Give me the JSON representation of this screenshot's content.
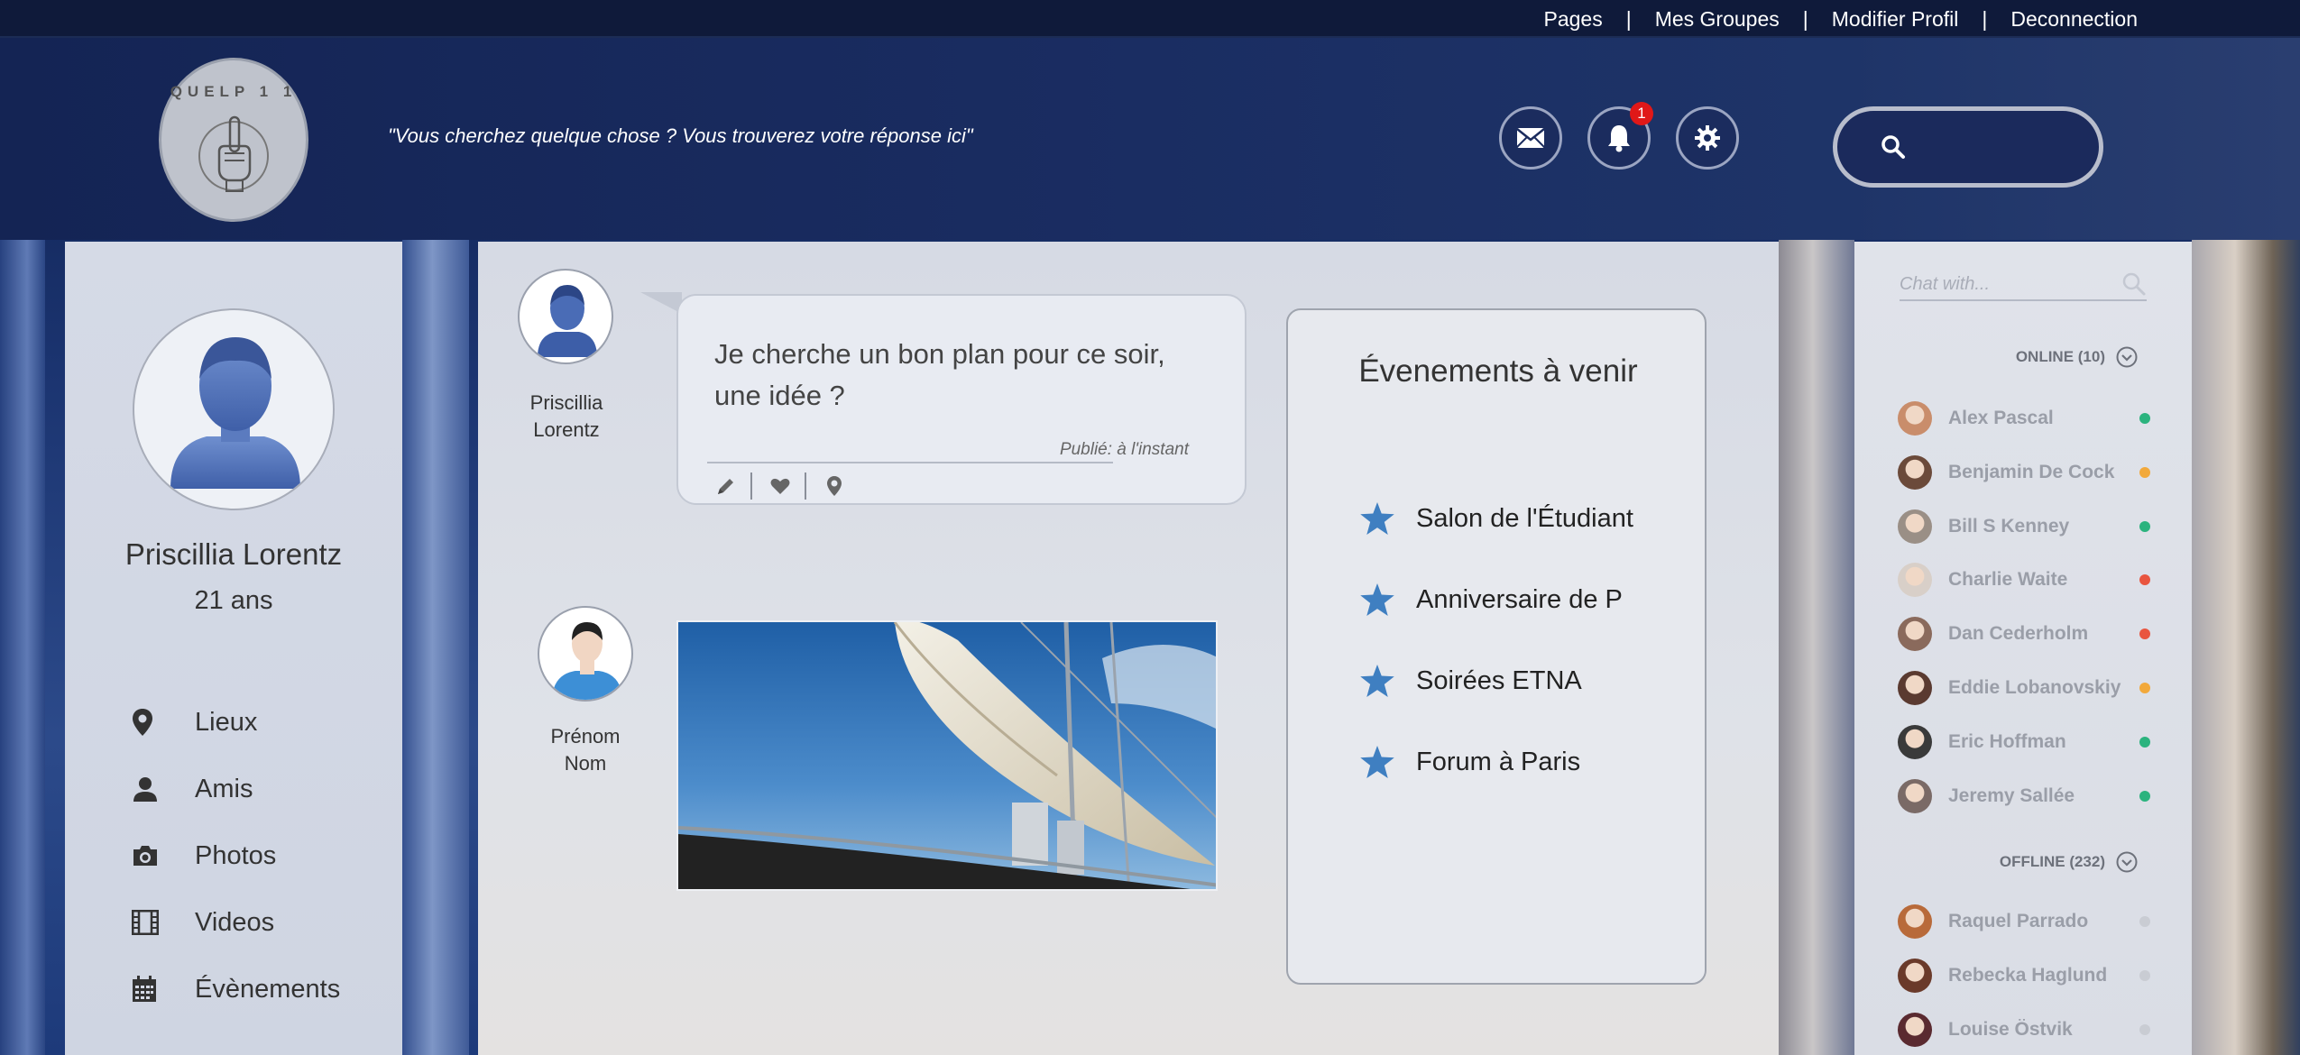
{
  "topnav": {
    "links": [
      "Pages",
      "Mes Groupes",
      "Modifier Profil",
      "Deconnection"
    ],
    "separator": "|"
  },
  "header": {
    "logo_text": "QUELP 1 1",
    "tagline": "\"Vous cherchez quelque chose ? Vous trouverez votre réponse ici\"",
    "notification_count": "1",
    "icons": [
      "mail-icon",
      "bell-icon",
      "gear-icon",
      "search-icon"
    ],
    "search_placeholder": ""
  },
  "profile": {
    "name": "Priscillia Lorentz",
    "age": "21 ans",
    "menu": [
      {
        "label": "Lieux",
        "icon": "map-pin-icon"
      },
      {
        "label": "Amis",
        "icon": "person-icon"
      },
      {
        "label": "Photos",
        "icon": "camera-icon"
      },
      {
        "label": "Videos",
        "icon": "film-icon"
      },
      {
        "label": "Évènements",
        "icon": "calendar-icon"
      }
    ]
  },
  "feed": {
    "post1": {
      "author_first": "Priscillia",
      "author_last": "Lorentz",
      "text": "Je cherche un bon plan pour ce soir, une idée ?",
      "timestamp": "Publié: à l'instant"
    },
    "post2": {
      "author_first": "Prénom",
      "author_last": "Nom"
    }
  },
  "events": {
    "title": "Évenements à venir",
    "items": [
      "Salon de l'Étudiant",
      "Anniversaire de P",
      "Soirées ETNA",
      "Forum à Paris"
    ],
    "star_color": "#3f7fc1"
  },
  "chat": {
    "search_placeholder": "Chat with...",
    "online_label": "ONLINE (10)",
    "offline_label": "OFFLINE (232)",
    "online": [
      {
        "name": "Alex Pascal",
        "status": "#2bb37e"
      },
      {
        "name": "Benjamin De Cock",
        "status": "#f2a93b"
      },
      {
        "name": "Bill S Kenney",
        "status": "#2bb37e"
      },
      {
        "name": "Charlie Waite",
        "status": "#e9553f"
      },
      {
        "name": "Dan Cederholm",
        "status": "#e9553f"
      },
      {
        "name": "Eddie Lobanovskiy",
        "status": "#f2a93b"
      },
      {
        "name": "Eric Hoffman",
        "status": "#2bb37e"
      },
      {
        "name": "Jeremy Sallée",
        "status": "#2bb37e"
      }
    ],
    "offline": [
      {
        "name": "Raquel Parrado",
        "status": "#c9ccd3"
      },
      {
        "name": "Rebecka Haglund",
        "status": "#c9ccd3"
      },
      {
        "name": "Louise Östvik",
        "status": "#c9ccd3"
      }
    ]
  }
}
